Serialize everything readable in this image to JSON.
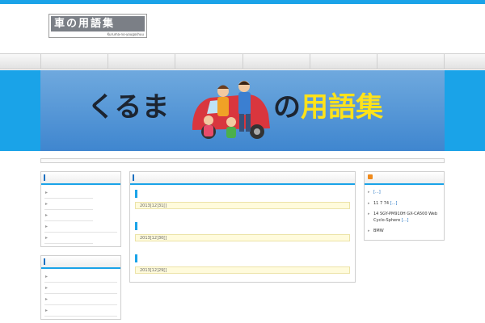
{
  "header": {
    "logo_title": "車の用語集",
    "logo_subtitle": "Kuruma-no-yougoshuu",
    "top_link": "",
    "tagline": ""
  },
  "nav": {
    "items": [
      "",
      "",
      "",
      "",
      "",
      ""
    ]
  },
  "hero": {
    "text_left": "くるま",
    "text_no": "の",
    "text_right": "用語集"
  },
  "sidebar_left": {
    "menu": {
      "title": "",
      "items": [
        "",
        "",
        "",
        "",
        ""
      ]
    },
    "categories": {
      "title": "",
      "items": [
        "",
        "",
        "",
        ""
      ]
    }
  },
  "main": {
    "title": "",
    "posts": [
      {
        "title": "",
        "meta": "2013[12]31[] ",
        "excerpt": ""
      },
      {
        "title": "",
        "meta": "2013[12]30[] ",
        "excerpt": ""
      },
      {
        "title": "",
        "meta": "2013[12]29[] ",
        "excerpt": ""
      }
    ]
  },
  "sidebar_right": {
    "rss": {
      "title": "",
      "items": [
        {
          "text": "",
          "more": "[...]"
        },
        {
          "text": "11 7 74",
          "more": "[...]"
        },
        {
          "text": "14 SGY-PM910H GX-CA500 Web Cyclo-Sphere",
          "more": "[...]"
        },
        {
          "text": "BMW",
          "more": ""
        }
      ]
    }
  },
  "colors": {
    "accent": "#1aa3e8",
    "banner_bg": "#5c9ad8",
    "banner_highlight": "#ffe21a",
    "meta_bg": "#fffbdc",
    "rss_orange": "#f08a1c"
  }
}
